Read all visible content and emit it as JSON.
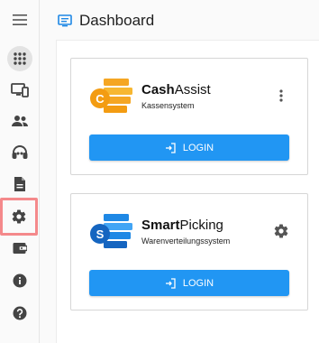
{
  "header": {
    "title": "Dashboard",
    "icon": "dashboard-icon"
  },
  "sidebar": {
    "items": [
      {
        "name": "menu",
        "icon": "hamburger-icon"
      },
      {
        "name": "apps",
        "icon": "apps-grid-icon",
        "active": true
      },
      {
        "name": "devices",
        "icon": "devices-icon"
      },
      {
        "name": "users",
        "icon": "people-icon"
      },
      {
        "name": "support",
        "icon": "headset-icon"
      },
      {
        "name": "documents",
        "icon": "document-icon"
      },
      {
        "name": "settings",
        "icon": "gear-icon",
        "highlighted": true
      },
      {
        "name": "wallet",
        "icon": "wallet-icon"
      },
      {
        "name": "info",
        "icon": "info-icon"
      },
      {
        "name": "help",
        "icon": "help-icon"
      }
    ]
  },
  "cards": [
    {
      "name_bold": "Cash",
      "name_rest": "Assist",
      "subtitle": "Kassensystem",
      "logo_letter": "C",
      "logo_color": "#f5a623",
      "action_icon": "more-vert-icon",
      "login_label": "LOGIN"
    },
    {
      "name_bold": "Smart",
      "name_rest": "Picking",
      "subtitle": "Warenverteilungssystem",
      "logo_letter": "S",
      "logo_color": "#1e88e5",
      "action_icon": "gear-icon",
      "login_label": "LOGIN"
    }
  ],
  "colors": {
    "accent": "#2196f3",
    "highlight_border": "#f4898b"
  }
}
